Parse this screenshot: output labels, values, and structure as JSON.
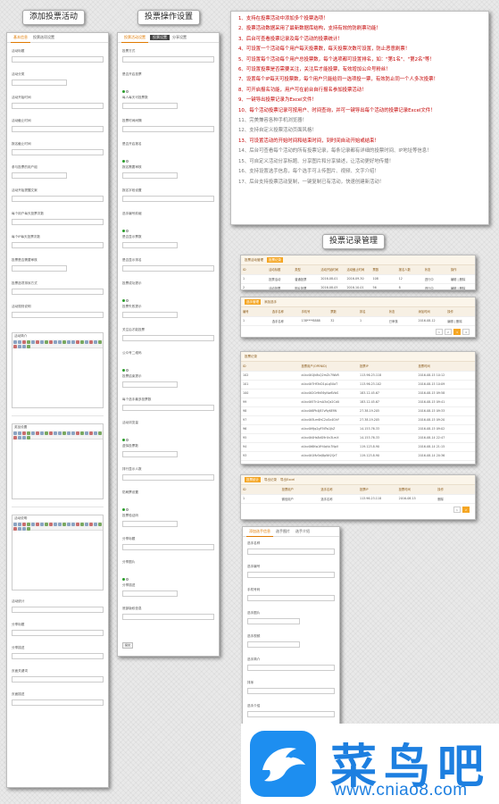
{
  "labels": {
    "add_activity": "添加投票活动",
    "vote_settings": "投票操作设置",
    "vote_records": "投票记录管理"
  },
  "panel_add": {
    "tabs": [
      "基本信息",
      "投票选项设置"
    ],
    "field_labels": [
      "活动标题",
      "活动分类",
      "活动开始时间",
      "活动截止时间",
      "报名截止时间",
      "参与投票的用户组",
      "活动开始提醒文案",
      "每个用户每天投票次数",
      "每个IP每天投票次数",
      "投票是否需要审核",
      "投票选项排序方式",
      "活动规则说明"
    ],
    "editor_labels": [
      "活动简介",
      "奖品设置",
      "活动说明"
    ],
    "bottom_labels": [
      "活动统计",
      "分享标题",
      "分享描述",
      "页面关键词",
      "页面描述"
    ]
  },
  "panel_settings": {
    "tabs": [
      "投票活动设置",
      "分享设置"
    ],
    "badge": "投票设置",
    "field_labels": [
      "投票方式",
      "是否开启投票",
      "每人每天可投票数",
      "投票时间间隔",
      "是否开启报名",
      "报名需要审核",
      "报名字段设置",
      "选手编号前缀",
      "是否显示票数",
      "是否显示排名",
      "投票成功提示",
      "投票失败提示",
      "关注后才能投票",
      "公众号二维码",
      "投票结束提示",
      "每个选手最多投票数",
      "活动浏览量",
      "虚拟投票数",
      "排行显示人数",
      "防刷票设置",
      "投票验证码",
      "分享标题",
      "分享图片",
      "分享描述",
      "底部版权信息"
    ],
    "submit": "提交"
  },
  "notes": [
    {
      "text": "1、支持在投票活动中添加多个投票选项！",
      "color": "red"
    },
    {
      "text": "2、投票活动数据采用了最新数据库结构，支持有效的防刷票功能！",
      "color": "red"
    },
    {
      "text": "3、后台可查看投票记录及每个活动的投票统计！",
      "color": "red"
    },
    {
      "text": "4、可设置一个活动每个用户每天投票数，每天投票次数可设置，防止恶意刷票！",
      "color": "red"
    },
    {
      "text": "5、可设置每个活动每个用户总投票数，每个选项都可设置排名，如：\"第1名\"、\"第2名\"等！",
      "color": "red"
    },
    {
      "text": "6、可设置投票是否需要关注，关注后才能投票，有效增加公众号粉丝！",
      "color": "red"
    },
    {
      "text": "7、设置每个IP每天可投票数，每个用户只能给同一选项投一票，有效防止同一个人多次投票！",
      "color": "red"
    },
    {
      "text": "8、可开启报名功能，用户可在前台自行报名参加投票活动！",
      "color": "red"
    },
    {
      "text": "9、一键导出投票记录为Excel文件！",
      "color": "red"
    },
    {
      "text": "10、每个活动投票记录可按用户、时间查询，并可一键导出每个活动的投票记录Excel文件！",
      "color": "red"
    },
    {
      "text": "11、完美兼容各种手机浏览器！",
      "color": "gray"
    },
    {
      "text": "12、支持自定义投票活动页面风格！",
      "color": "gray"
    },
    {
      "text": "13、可设置活动的开始时间和结束时间，到时间自动开始或结束！",
      "color": "red"
    },
    {
      "text": "14、后台可查看每个活动的所有投票记录，每条记录都有详细的投票时间、IP地址等信息！",
      "color": "gray"
    },
    {
      "text": "15、可自定义活动分享标题、分享图片和分享描述，让活动更好地传播！",
      "color": "gray"
    },
    {
      "text": "16、支持设置选手信息，每个选手可上传图片、视频、文字介绍！",
      "color": "gray"
    },
    {
      "text": "17、后台支持投票活动复制，一键复制已有活动，快速创建新活动！",
      "color": "gray"
    }
  ],
  "records_table_1": {
    "tabs": [
      "投票活动管理",
      "投票记录"
    ],
    "headers": [
      "ID",
      "活动标题",
      "类型",
      "活动开始时间",
      "活动截止时间",
      "票数",
      "报名人数",
      "状态",
      "操作"
    ],
    "rows": [
      [
        "1",
        "投票活动",
        "普通投票",
        "2016-08-01",
        "2016-09-30",
        "108",
        "12",
        "进行中",
        "编辑 | 删除"
      ],
      [
        "2",
        "活动投票",
        "图片投票",
        "2016-08-05",
        "2016-10-01",
        "56",
        "8",
        "进行中",
        "编辑 | 删除"
      ]
    ]
  },
  "records_table_2": {
    "tabs": [
      "选手管理",
      "添加选手"
    ],
    "headers": [
      "编号",
      "选手名称",
      "手机号",
      "票数",
      "排名",
      "状态",
      "添加时间",
      "操作"
    ],
    "rows": [
      [
        "1",
        "选手名称",
        "138****8888",
        "32",
        "1",
        "已审核",
        "2016-08-12",
        "编辑 | 删除"
      ]
    ]
  },
  "records_table_3": {
    "breadcrumb": "投票记录",
    "headers": [
      "ID",
      "投票用户(OPENID)",
      "投票IP",
      "投票时间"
    ],
    "rows": [
      [
        "102",
        "oUxv0t1Jk8sQ2mZc7WbR",
        "113.96.23.118",
        "2016-08-15 10:12"
      ],
      [
        "101",
        "oUxv0t7Hf3nD1pLq5XaT",
        "113.96.23.102",
        "2016-08-15 10:09"
      ],
      [
        "100",
        "oUxv0t2Gr9kE6yNw8VbS",
        "183.12.45.67",
        "2016-08-15 09:58"
      ],
      [
        "99",
        "oUxv0t5Tn1mA3xQz2CdU",
        "183.12.45.67",
        "2016-08-15 09:41"
      ],
      [
        "98",
        "oUxv0t8Pk4jB7vRy6EfW",
        "27.38.19.205",
        "2016-08-15 09:33"
      ],
      [
        "97",
        "oUxv0t3Lm6hC2uSx4GhY",
        "27.38.19.205",
        "2016-08-15 09:20"
      ],
      [
        "96",
        "oUxv0t9Jq2gF5tTw1JkZ",
        "14.153.76.33",
        "2016-08-15 09:02"
      ],
      [
        "95",
        "oUxv0t4Hs8dG9rUv3LmX",
        "14.153.76.33",
        "2016-08-14 22:47"
      ],
      [
        "94",
        "oUxv0t6Kw1fH4qVu7NpV",
        "119.123.8.90",
        "2016-08-14 21:15"
      ],
      [
        "93",
        "oUxv0t1Mz5eJ8pWt2QrT",
        "119.123.8.90",
        "2016-08-14 20:36"
      ]
    ]
  },
  "records_table_4": {
    "tabs": [
      "投票统计",
      "导出记录",
      "导出Excel"
    ],
    "headers": [
      "ID",
      "投票用户",
      "选手名称",
      "投票IP",
      "投票时间",
      "操作"
    ],
    "rows": [
      [
        "1",
        "微信用户",
        "选手名称",
        "113.96.23.118",
        "2016-08-15",
        "删除"
      ]
    ]
  },
  "panel_contestant": {
    "tabs": [
      "添加选手信息",
      "选手图片",
      "选手介绍"
    ],
    "field_labels": [
      "选手名称",
      "选手编号",
      "手机号码",
      "选手图片",
      "选手视频",
      "选手简介",
      "排序",
      "选手介绍"
    ],
    "upload": "上传"
  },
  "brand": {
    "name": "菜鸟吧",
    "url": "www.cniao8.com",
    "color": "#1d7fe0"
  }
}
